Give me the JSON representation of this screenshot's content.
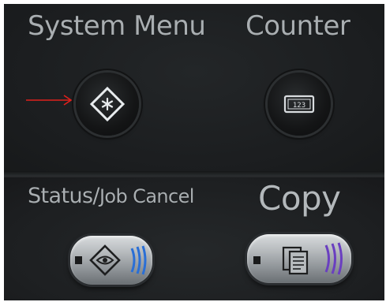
{
  "labels": {
    "system_menu": "System Menu",
    "counter": "Counter",
    "status": "Status/",
    "job_cancel": "Job Cancel",
    "copy": "Copy"
  },
  "icons": {
    "system_menu_button": "diamond-asterisk-icon",
    "counter_button": "counter-display-icon",
    "status_button": "diamond-eye-icon",
    "copy_button": "documents-icon",
    "pointer": "red-arrow-icon"
  },
  "counter_display_text": "123",
  "colors": {
    "panel": "#1c1e20",
    "label_text": "#a9aeb1",
    "arrow": "#e0201c",
    "status_indicator": "#2a6fd6",
    "copy_indicator": "#6a3fc0"
  }
}
